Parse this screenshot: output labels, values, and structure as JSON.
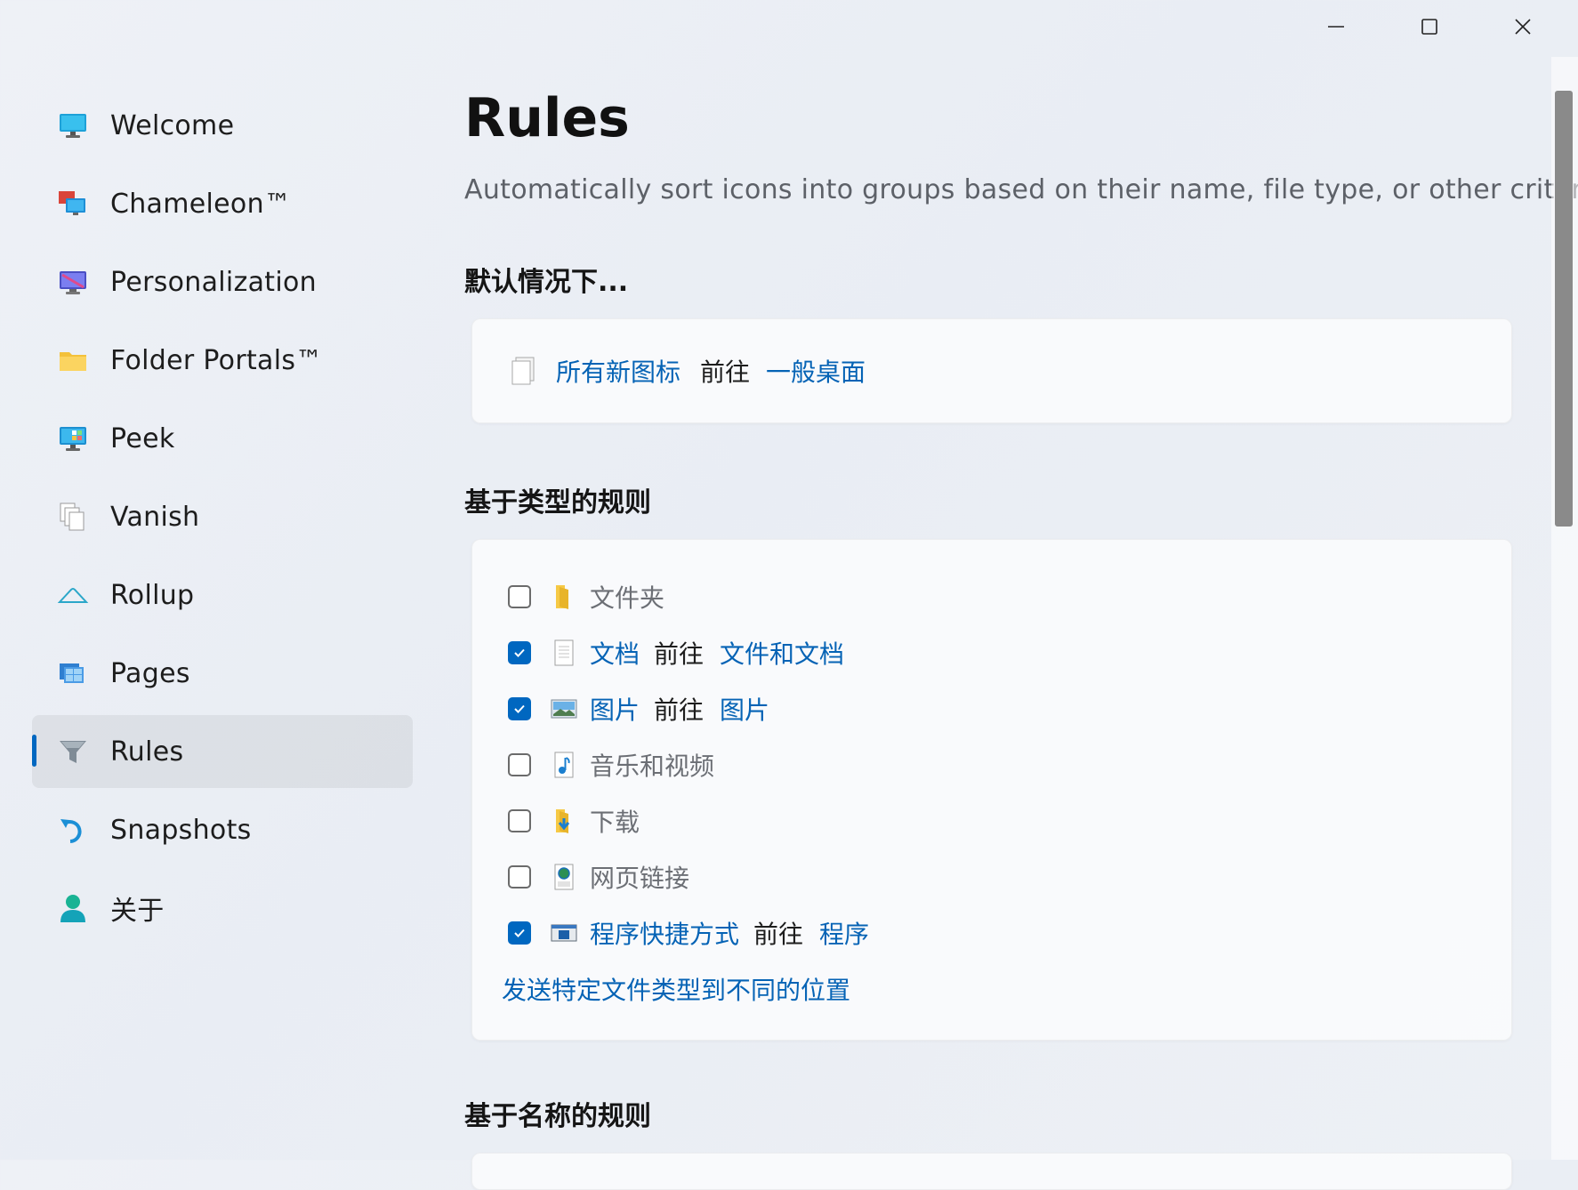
{
  "window": {
    "controls": {
      "minimize": "minimize-icon",
      "maximize": "maximize-icon",
      "close": "close-icon"
    }
  },
  "sidebar": {
    "items": [
      {
        "label": "Welcome",
        "icon": "monitor-icon"
      },
      {
        "label": "Chameleon™",
        "icon": "chameleon-icon"
      },
      {
        "label": "Personalization",
        "icon": "personalization-icon"
      },
      {
        "label": "Folder Portals™",
        "icon": "folder-icon"
      },
      {
        "label": "Peek",
        "icon": "peek-monitor-icon"
      },
      {
        "label": "Vanish",
        "icon": "vanish-icon"
      },
      {
        "label": "Rollup",
        "icon": "rollup-icon"
      },
      {
        "label": "Pages",
        "icon": "pages-icon"
      },
      {
        "label": "Rules",
        "icon": "funnel-icon",
        "active": true
      },
      {
        "label": "Snapshots",
        "icon": "snapshot-icon"
      },
      {
        "label": "关于",
        "icon": "person-icon"
      }
    ]
  },
  "main": {
    "title": "Rules",
    "subtitle": "Automatically sort icons into groups based on their name, file type, or other criteria.",
    "default_section": {
      "title": "默认情况下...",
      "source": "所有新图标",
      "verb": "前往",
      "target": "一般桌面"
    },
    "type_section": {
      "title": "基于类型的规则",
      "rules": [
        {
          "name": "文件夹",
          "checked": false,
          "icon": "folder-icon"
        },
        {
          "name": "文档",
          "checked": true,
          "verb": "前往",
          "target": "文件和文档",
          "icon": "document-icon"
        },
        {
          "name": "图片",
          "checked": true,
          "verb": "前往",
          "target": "图片",
          "icon": "picture-icon"
        },
        {
          "name": "音乐和视频",
          "checked": false,
          "icon": "music-icon"
        },
        {
          "name": "下载",
          "checked": false,
          "icon": "download-folder-icon"
        },
        {
          "name": "网页链接",
          "checked": false,
          "icon": "web-link-icon"
        },
        {
          "name": "程序快捷方式",
          "checked": true,
          "verb": "前往",
          "target": "程序",
          "icon": "shortcut-icon"
        }
      ],
      "footer_link": "发送特定文件类型到不同的位置"
    },
    "name_section": {
      "title": "基于名称的规则"
    }
  },
  "colors": {
    "accent": "#0067c0",
    "link": "#0563b5"
  }
}
